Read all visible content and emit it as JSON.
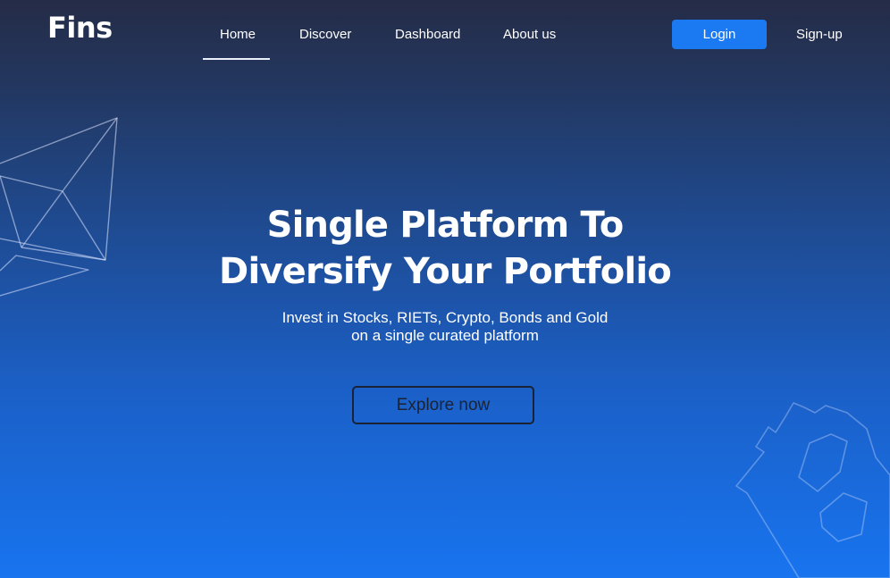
{
  "header": {
    "logo": "Fins",
    "nav": [
      {
        "label": "Home",
        "active": true
      },
      {
        "label": "Discover"
      },
      {
        "label": "Dashboard"
      },
      {
        "label": "About us"
      }
    ],
    "login_label": "Login",
    "signup_label": "Sign-up"
  },
  "hero": {
    "title_line1": "Single Platform To",
    "title_line2": "Diversify Your Portfolio",
    "subtitle_line1": "Invest in Stocks, RIETs, Crypto, Bonds and Gold",
    "subtitle_line2": "on a single curated platform",
    "cta_label": "Explore now"
  },
  "colors": {
    "accent": "#1b7af2",
    "background_top": "#252c47",
    "background_bottom": "#1874ef",
    "cta_border": "#1a2235"
  },
  "decorations": {
    "left": "ethereum-icon",
    "right": "bitcoin-icon"
  }
}
